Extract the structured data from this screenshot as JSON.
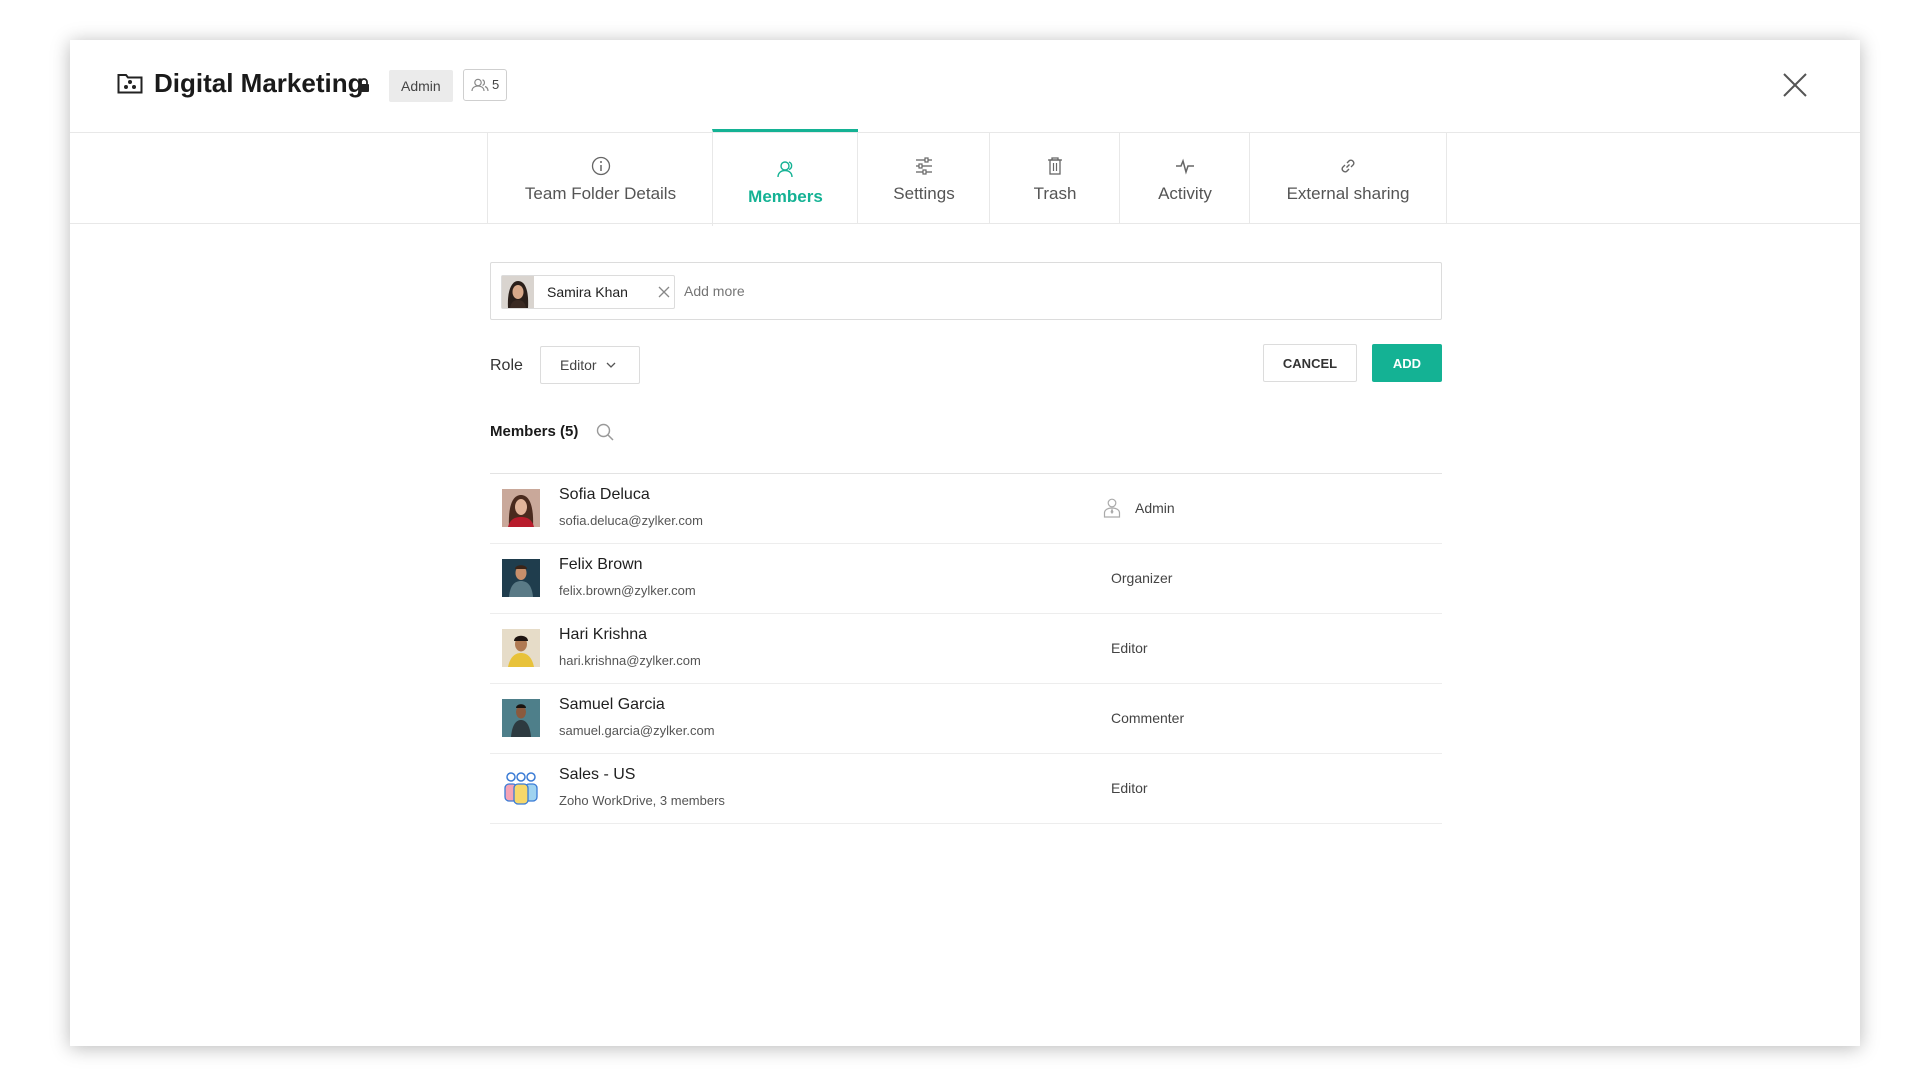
{
  "header": {
    "title": "Digital Marketing",
    "role_badge": "Admin",
    "member_count": "5"
  },
  "tabs": [
    {
      "label": "Team Folder Details",
      "icon": "info-icon"
    },
    {
      "label": "Members",
      "icon": "members-icon",
      "active": true
    },
    {
      "label": "Settings",
      "icon": "settings-sliders-icon"
    },
    {
      "label": "Trash",
      "icon": "trash-icon"
    },
    {
      "label": "Activity",
      "icon": "activity-icon"
    },
    {
      "label": "External sharing",
      "icon": "link-icon"
    }
  ],
  "invite": {
    "chip_name": "Samira Khan",
    "placeholder": "Add more"
  },
  "role": {
    "label": "Role",
    "selected": "Editor"
  },
  "buttons": {
    "cancel": "CANCEL",
    "add": "ADD"
  },
  "members": {
    "title": "Members (5)",
    "items": [
      {
        "name": "Sofia Deluca",
        "email": "sofia.deluca@zylker.com",
        "role": "Admin"
      },
      {
        "name": "Felix Brown",
        "email": "felix.brown@zylker.com",
        "role": "Organizer"
      },
      {
        "name": "Hari Krishna",
        "email": "hari.krishna@zylker.com",
        "role": "Editor"
      },
      {
        "name": "Samuel Garcia",
        "email": "samuel.garcia@zylker.com",
        "role": "Commenter"
      },
      {
        "name": "Sales - US",
        "email": "Zoho WorkDrive, 3 members",
        "role": "Editor"
      }
    ]
  },
  "colors": {
    "accent": "#14b294"
  }
}
